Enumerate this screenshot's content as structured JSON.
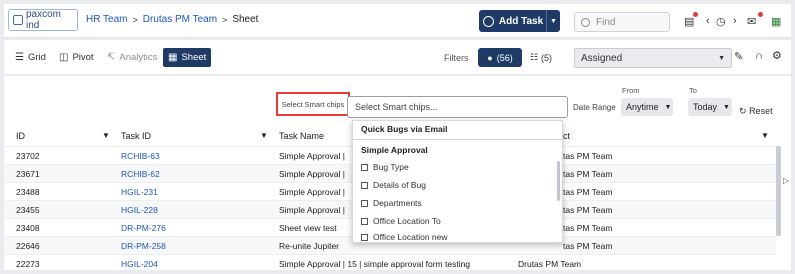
{
  "topbar": {
    "logo_text": "paxcom ind",
    "breadcrumbs": [
      "HR Team",
      "Drutas PM Team",
      "Sheet"
    ],
    "add_task_label": "Add Task",
    "find_placeholder": "Find"
  },
  "toolbar": {
    "tabs": [
      {
        "icon": "list-icon",
        "label": "Grid"
      },
      {
        "icon": "pivot-icon",
        "label": "Pivot"
      },
      {
        "icon": "analytics-icon",
        "label": "Analytics"
      },
      {
        "icon": "sheet-icon",
        "label": "Sheet"
      }
    ],
    "filters_label": "Filters",
    "filter_active_count": "(56)",
    "filter_other_count": "(5)",
    "assigned_value": "Assigned"
  },
  "filterbar": {
    "smart_chips_label": "Select Smart chips",
    "smart_chips_placeholder": "Select Smart chips...",
    "date_range_label": "Date Range",
    "from_label": "From",
    "from_value": "Anytime",
    "to_label": "To",
    "to_value": "Today",
    "reset_label": "Reset"
  },
  "table": {
    "columns": [
      "ID",
      "Task ID",
      "Task Name",
      "ct"
    ],
    "rows": [
      {
        "id": "23702",
        "task_id": "RCHIB-63",
        "name": "Simple Approval |",
        "project": "tas PM Team"
      },
      {
        "id": "23671",
        "task_id": "RCHIB-62",
        "name": "Simple Approval |",
        "project": "tas PM Team"
      },
      {
        "id": "23488",
        "task_id": "HGIL-231",
        "name": "Simple Approval |",
        "project": "tas PM Team"
      },
      {
        "id": "23455",
        "task_id": "HGIL-228",
        "name": "Simple Approval |",
        "project": "tas PM Team"
      },
      {
        "id": "23408",
        "task_id": "DR-PM-276",
        "name": "Sheet view test",
        "project": "tas PM Team"
      },
      {
        "id": "22646",
        "task_id": "DR-PM-258",
        "name": "Re-unite Jupiter",
        "project": "tas PM Team"
      },
      {
        "id": "22273",
        "task_id": "HGIL-204",
        "name": "Simple Approval | 15 | simple approval form testing",
        "project": "Drutas PM Team"
      }
    ]
  },
  "dropdown": {
    "group1": "Quick Bugs via Email",
    "group2": "Simple Approval",
    "options": [
      "Bug Type",
      "Details of Bug",
      "Departments",
      "Office Location To",
      "Office Location new"
    ]
  }
}
